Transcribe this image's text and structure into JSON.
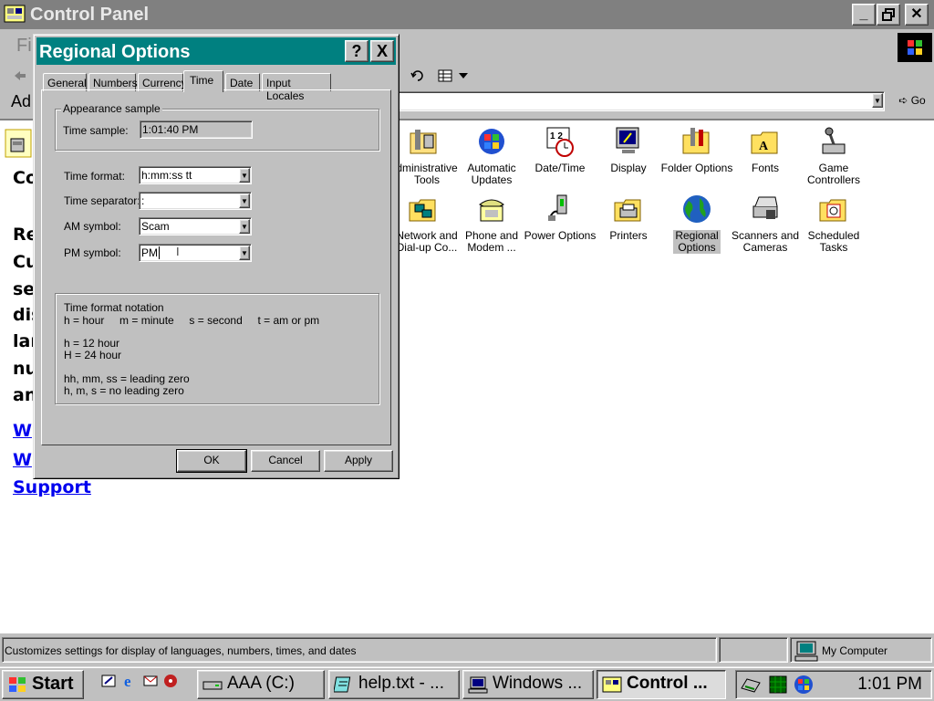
{
  "main_window": {
    "title": "Control Panel",
    "menu_stub": "Fi",
    "address_label": "Ad",
    "go_label": "Go",
    "left_pane": {
      "heading": "Co",
      "lines": [
        "Re",
        "Cu",
        "se",
        "dis",
        "lar",
        "nu",
        "an"
      ],
      "links": [
        "W",
        "W",
        "Support"
      ]
    },
    "icons": [
      {
        "name": "administrative-tools",
        "label": "Administrative\nTools",
        "display": "dministrative\nTools"
      },
      {
        "name": "automatic-updates",
        "label": "Automatic\nUpdates"
      },
      {
        "name": "date-time",
        "label": "Date/Time"
      },
      {
        "name": "display",
        "label": "Display"
      },
      {
        "name": "folder-options",
        "label": "Folder Options"
      },
      {
        "name": "fonts",
        "label": "Fonts"
      },
      {
        "name": "game-controllers",
        "label": "Game\nControllers"
      },
      {
        "name": "network-and-dialup",
        "label": "Network and\nDial-up Co...",
        "display": "Network and\nDial-up Co..."
      },
      {
        "name": "phone-and-modem",
        "label": "Phone and\nModem ..."
      },
      {
        "name": "power-options",
        "label": "Power Options"
      },
      {
        "name": "printers",
        "label": "Printers"
      },
      {
        "name": "regional-options",
        "label": "Regional\nOptions",
        "selected": true
      },
      {
        "name": "scanners-and-cameras",
        "label": "Scanners and\nCameras"
      },
      {
        "name": "scheduled-tasks",
        "label": "Scheduled\nTasks"
      }
    ],
    "status_text": "Customizes settings for display of languages, numbers, times, and dates",
    "status_zone": "My Computer"
  },
  "dialog": {
    "title": "Regional Options",
    "help_label": "?",
    "close_label": "X",
    "tabs": [
      "General",
      "Numbers",
      "Currency",
      "Time",
      "Date",
      "Input Locales"
    ],
    "active_tab": "Time",
    "appearance_group": {
      "legend": "Appearance sample",
      "time_sample_label": "Time sample:",
      "time_sample_value": "1:01:40 PM"
    },
    "time_format_label": "Time format:",
    "time_format_value": "h:mm:ss tt",
    "time_separator_label": "Time separator:",
    "time_separator_value": ":",
    "am_symbol_label": "AM symbol:",
    "am_symbol_value": "Scam",
    "pm_symbol_label": "PM symbol:",
    "pm_symbol_value": "PM",
    "notation_group": {
      "title": "Time format notation",
      "line1": "h = hour     m = minute     s = second     t = am or pm",
      "line2": "h = 12 hour",
      "line3": "H = 24 hour",
      "line4": "hh, mm, ss = leading zero",
      "line5": "h, m, s = no leading zero"
    },
    "ok_label": "OK",
    "cancel_label": "Cancel",
    "apply_label": "Apply"
  },
  "taskbar": {
    "start_label": "Start",
    "tasks": [
      "AAA (C:)",
      "help.txt - ...",
      "Windows ...",
      "Control ..."
    ],
    "active_task": "Control ...",
    "clock": "1:01 PM"
  },
  "colors": {
    "dialog_title": "#008080",
    "inactive_title": "#808080",
    "face": "#c0c0c0",
    "link": "#0000ee"
  }
}
